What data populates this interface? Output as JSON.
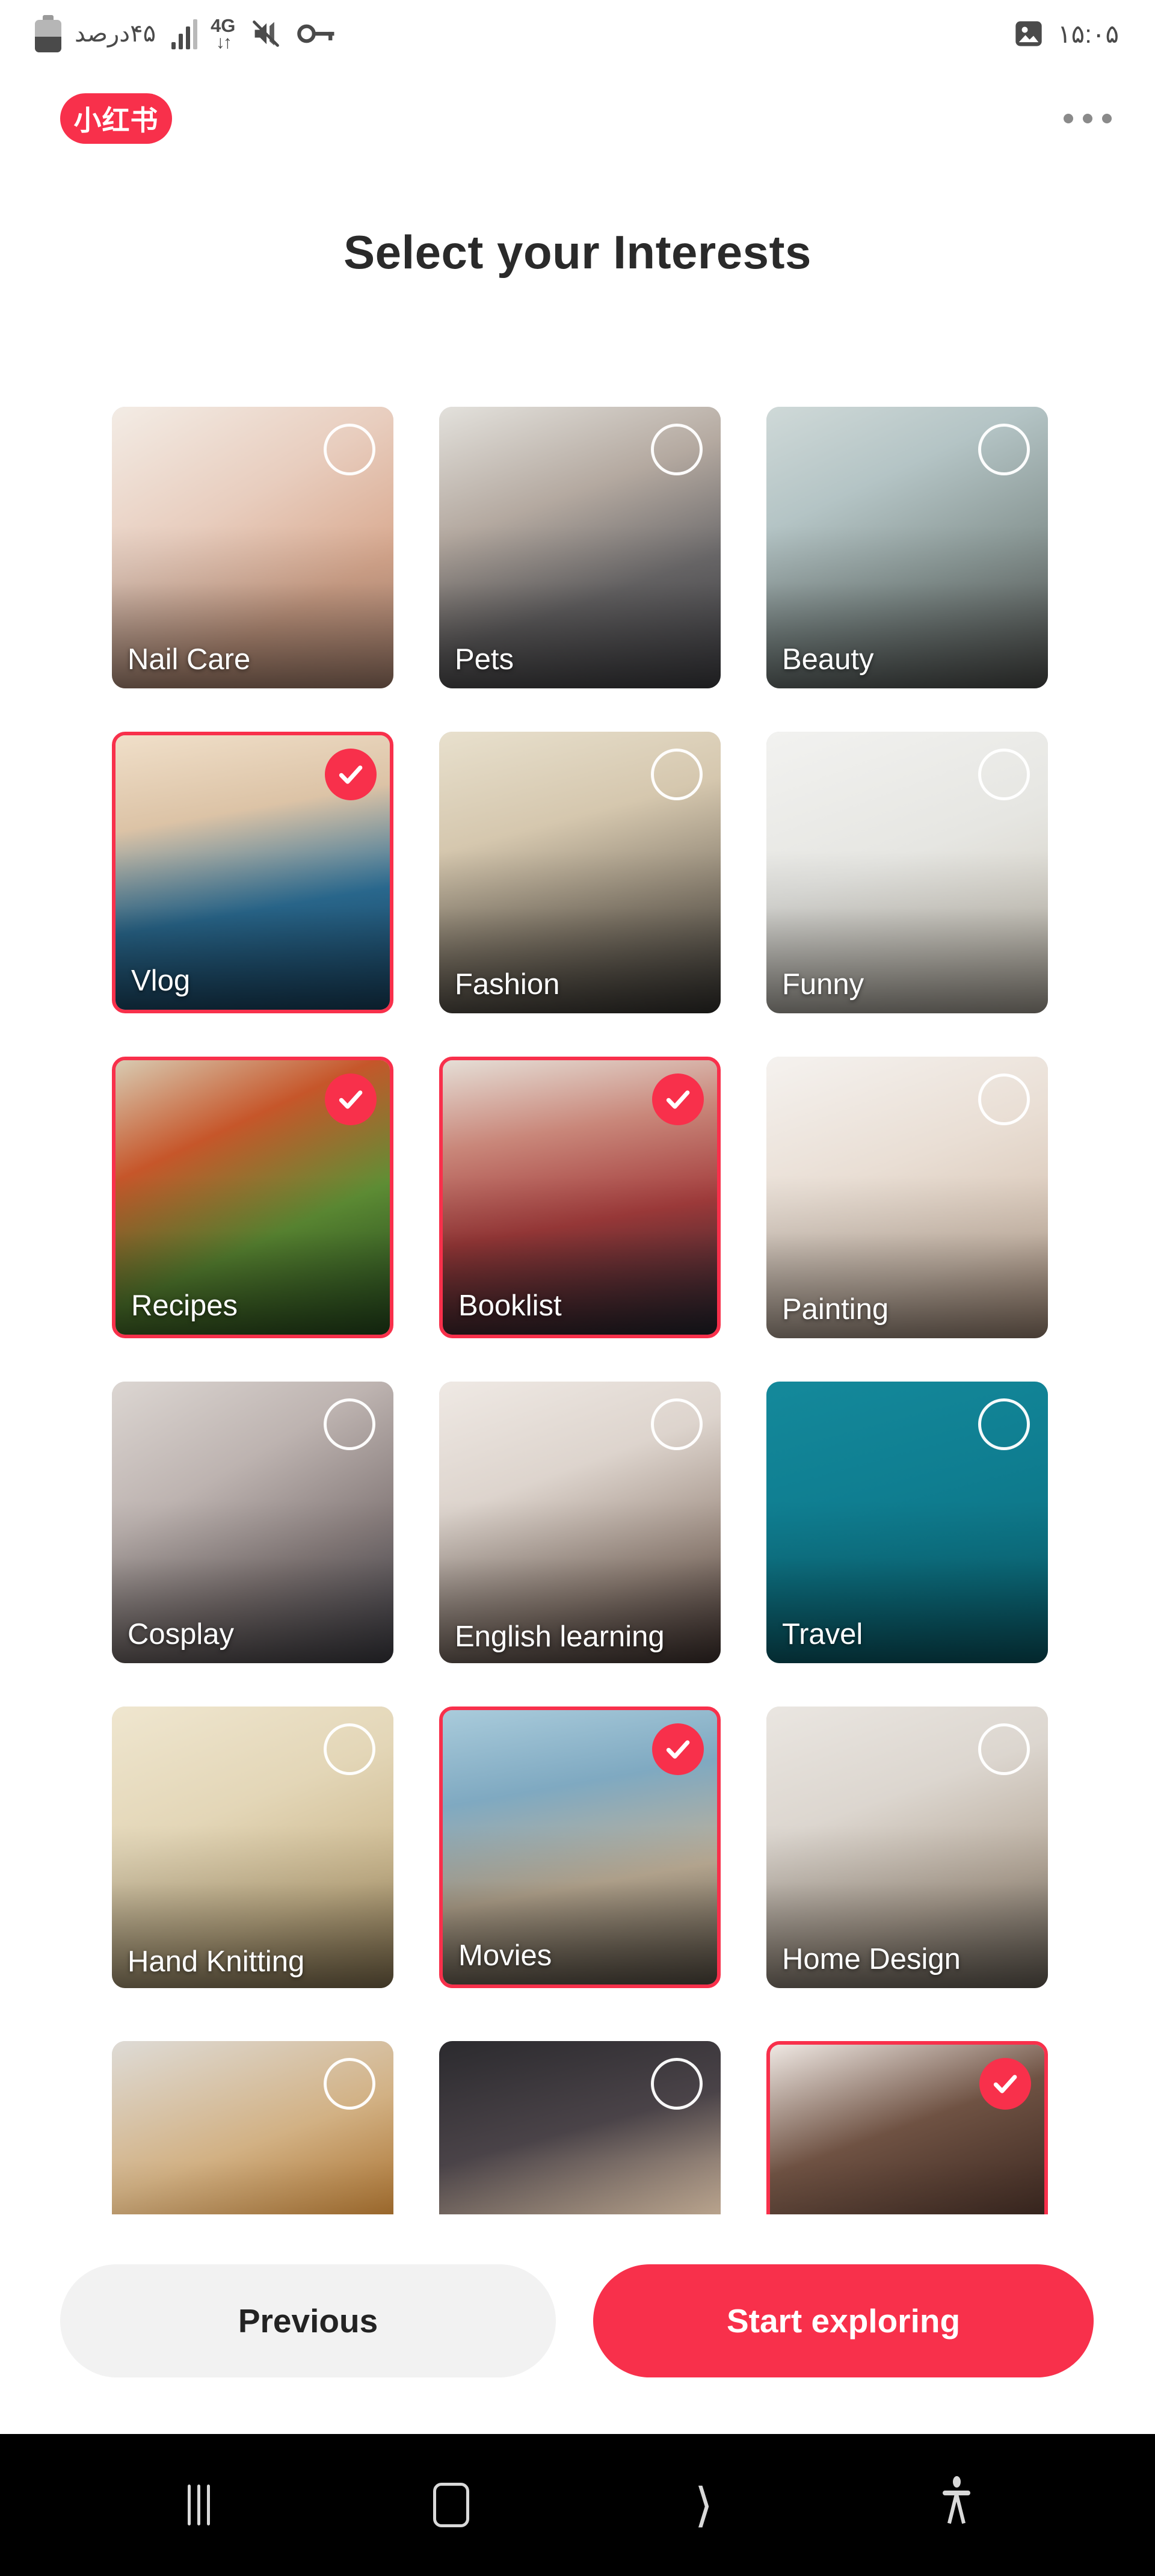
{
  "status_bar": {
    "battery_text": "۴۵درصد",
    "battery_level_percent": 45,
    "network_generation": "4G",
    "data_arrows": "↓↑",
    "icons": [
      "battery-icon",
      "signal-bars-icon",
      "4g-data-icon",
      "mute-icon",
      "vpn-key-icon",
      "screenshot-image-icon"
    ],
    "clock": "۱۵:۰۵"
  },
  "header": {
    "brand_logo_text": "小红书",
    "brand_color": "#F8304B",
    "more_menu_label": "•••"
  },
  "page": {
    "title": "Select your Interests"
  },
  "grid": {
    "columns": 3,
    "cards": [
      {
        "label": "Nail Care",
        "selected": false,
        "image": "nail-polish-manicure-photo",
        "bg": "linear-gradient(150deg,#f3ece5 0%,#e8cdbe 38%,#d9a98f 70%,#c99b84 100%)"
      },
      {
        "label": "Pets",
        "selected": false,
        "image": "man-hugging-bulldog-photo",
        "bg": "linear-gradient(160deg,#e3e1dc 0%,#b4a9a0 35%,#6d6b6c 65%,#4b4b50 100%)"
      },
      {
        "label": "Beauty",
        "selected": false,
        "image": "makeup-powder-brushes-photo",
        "bg": "linear-gradient(155deg,#cfd9d8 0%,#b4c4c5 30%,#8c9a98 60%,#5b5d5a 100%)"
      },
      {
        "label": "Vlog",
        "selected": true,
        "image": "phone-tripod-vlogger-photo",
        "bg": "linear-gradient(170deg,#f0dfc9 0%,#dcc3a6 30%,#2c6f97 62%,#1d4f72 100%)"
      },
      {
        "label": "Fashion",
        "selected": false,
        "image": "woman-beige-dress-photo",
        "bg": "linear-gradient(165deg,#e8e0cd 0%,#d5c7ae 34%,#8a8070 66%,#3c3a36 100%)"
      },
      {
        "label": "Funny",
        "selected": false,
        "image": "rubber-chicken-funny-photo",
        "bg": "linear-gradient(160deg,#f2f2f0 0%,#e6e6e2 45%,#d7d3c9 75%,#c4bdb0 100%)"
      },
      {
        "label": "Recipes",
        "selected": true,
        "image": "noodle-soup-bowl-photo",
        "bg": "linear-gradient(155deg,#d8cbb2 0%,#c6562a 30%,#5f8f35 62%,#2f5b24 100%)"
      },
      {
        "label": "Booklist",
        "selected": true,
        "image": "stacked-books-photo",
        "bg": "linear-gradient(170deg,#e5ded6 0%,#c9877a 28%,#a33c3c 58%,#2c2c38 100%)"
      },
      {
        "label": "Painting",
        "selected": false,
        "image": "hand-painting-flowers-photo",
        "bg": "linear-gradient(160deg,#f5f2ef 0%,#e9ded4 40%,#d8c6b6 72%,#b99d88 100%)"
      },
      {
        "label": "Cosplay",
        "selected": false,
        "image": "blurred-convention-photo",
        "bg": "linear-gradient(150deg,#dcd6d2 0%,#bdb3b0 35%,#8a7f7e 65%,#4b4a52 100%)"
      },
      {
        "label": "English learning",
        "selected": false,
        "image": "english-morning-reading-photo",
        "bg": "linear-gradient(160deg,#efe9e4 0%,#ddd4cd 35%,#9c8b80 70%,#4c3c38 100%)"
      },
      {
        "label": "Travel",
        "selected": false,
        "image": "hot-air-balloons-photo",
        "bg": "linear-gradient(165deg,#14899b 0%,#0f7e91 40%,#0c7283 75%,#0a6574 100%)"
      },
      {
        "label": "Hand Knitting",
        "selected": false,
        "image": "woman-knitting-yarn-photo",
        "bg": "linear-gradient(158deg,#efe6cf 0%,#e3d6b7 38%,#cdb98f 70%,#a18b61 100%)"
      },
      {
        "label": "Movies",
        "selected": true,
        "image": "film-clapperboard-photo",
        "bg": "linear-gradient(170deg,#a9cbdb 0%,#7fa9c1 30%,#c0b098 62%,#6d6355 100%)"
      },
      {
        "label": "Home Design",
        "selected": false,
        "image": "living-room-interior-photo",
        "bg": "linear-gradient(160deg,#eae6e1 0%,#dcd6cf 35%,#b8ab9c 68%,#7d7468 100%)"
      }
    ],
    "partial_row": [
      {
        "label": "",
        "selected": false,
        "image": "donut-sprinkles-photo",
        "bg": "linear-gradient(160deg,#dedbd6 0%,#d2b184 40%,#a9712f 72%,#6d4218 100%)"
      },
      {
        "label": "",
        "selected": false,
        "image": "wedding-couple-photo",
        "bg": "linear-gradient(165deg,#2b2a2e 0%,#4a4348 35%,#cdb59c 70%,#1d1c20 100%)"
      },
      {
        "label": "",
        "selected": true,
        "image": "braided-updo-hairstyle-photo",
        "bg": "linear-gradient(160deg,#efe8e3 0%,#6f5243 35%,#3e2a22 70%,#21150f 100%)"
      }
    ]
  },
  "footer": {
    "previous_label": "Previous",
    "start_exploring_label": "Start exploring",
    "accent_color": "#F8304B"
  },
  "android_nav": {
    "recents_label": "recents",
    "home_label": "home",
    "back_label": "back",
    "accessibility_label": "accessibility"
  }
}
